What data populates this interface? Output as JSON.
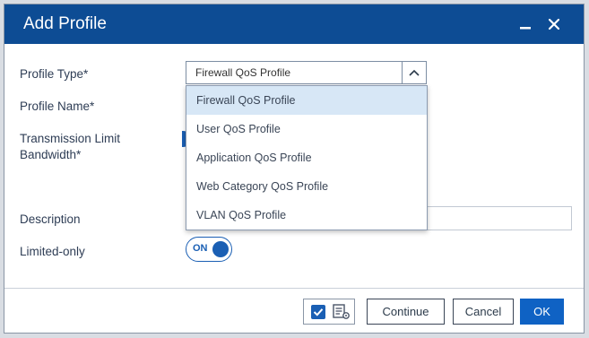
{
  "dialog": {
    "title": "Add Profile",
    "minimize_icon": "minimize-icon",
    "close_icon": "close-icon"
  },
  "form": {
    "profile_type_label": "Profile Type*",
    "profile_name_label": "Profile Name*",
    "transmission_label_line1": "Transmission Limit",
    "transmission_label_line2": "Bandwidth*",
    "description_label": "Description",
    "limited_only_label": "Limited-only",
    "profile_type_value": "Firewall QoS Profile",
    "limited_only_toggle": "ON",
    "description_value": ""
  },
  "dropdown": {
    "options": [
      "Firewall QoS Profile",
      "User QoS Profile",
      "Application QoS Profile",
      "Web Category QoS Profile",
      "VLAN QoS Profile"
    ],
    "selected": "Firewall QoS Profile"
  },
  "footer": {
    "continue_label": "Continue",
    "cancel_label": "Cancel",
    "ok_label": "OK"
  },
  "colors": {
    "titlebar": "#0d4c94",
    "primary": "#0f62c4",
    "selected_option": "#d7e7f6"
  }
}
